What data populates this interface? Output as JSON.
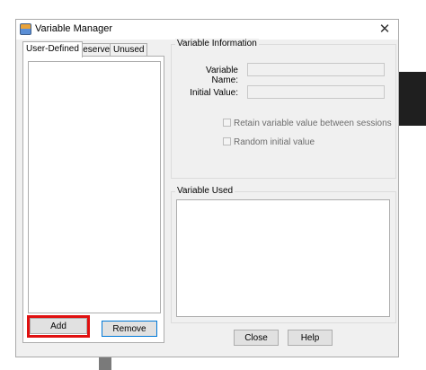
{
  "window": {
    "title": "Variable Manager",
    "close_glyph": "✕"
  },
  "tabs": [
    {
      "label": "User-Defined",
      "active": true
    },
    {
      "label": "Reserved",
      "active": false
    },
    {
      "label": "Unused",
      "active": false
    }
  ],
  "left_panel": {
    "add_label": "Add",
    "remove_label": "Remove"
  },
  "variable_information": {
    "legend": "Variable Information",
    "name_label": "Variable Name:",
    "name_value": "",
    "initial_label": "Initial Value:",
    "initial_value": "",
    "retain_label": "Retain variable value between sessions",
    "retain_checked": false,
    "random_label": "Random initial value",
    "random_checked": false
  },
  "variable_used": {
    "legend": "Variable Used"
  },
  "footer": {
    "close_label": "Close",
    "help_label": "Help"
  },
  "colors": {
    "highlight": "#e01010",
    "focus_border": "#0078d7",
    "dialog_bg": "#f0f0f0"
  }
}
